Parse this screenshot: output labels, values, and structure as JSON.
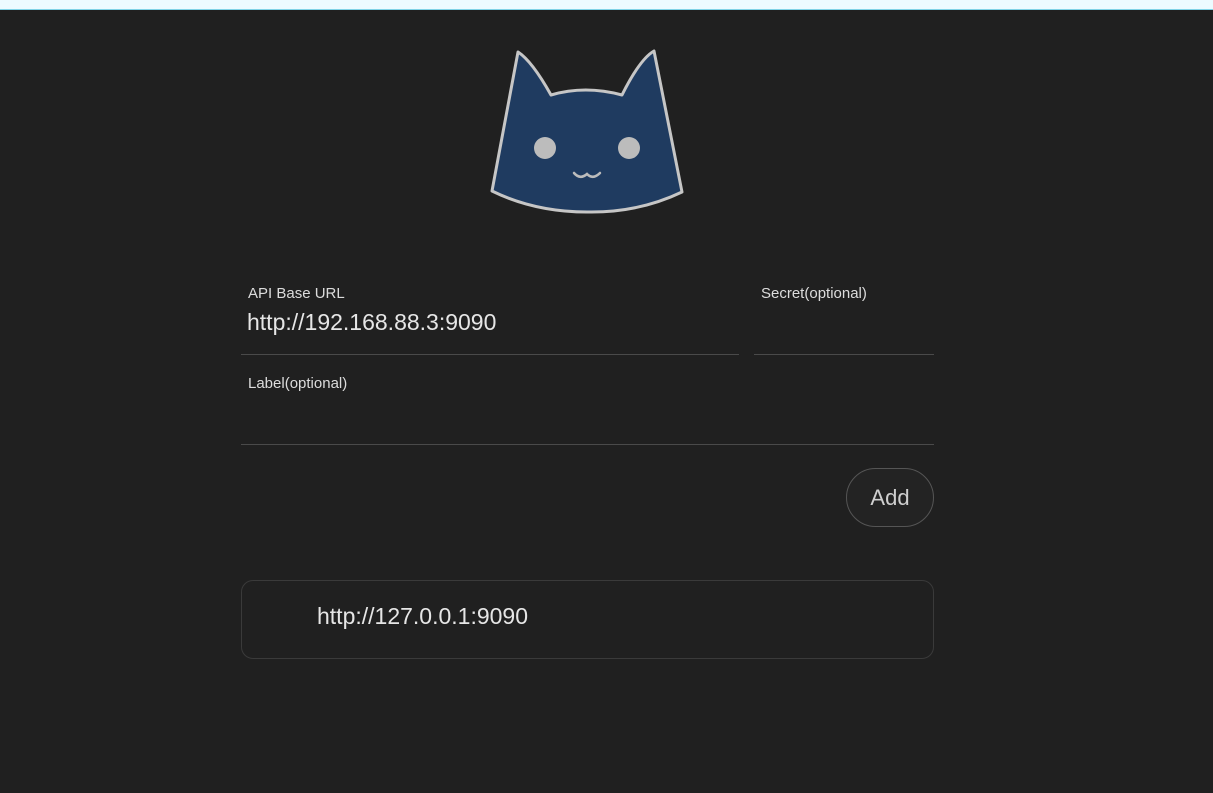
{
  "colors": {
    "background": "#202020",
    "logo_fill": "#1f3b60",
    "logo_stroke": "#c6c6c6",
    "divider": "#4a4a4a"
  },
  "logo": {
    "icon": "cat-face-icon"
  },
  "form": {
    "api_base_url": {
      "label": "API Base URL",
      "value": "http://192.168.88.3:9090"
    },
    "secret": {
      "label": "Secret(optional)",
      "value": ""
    },
    "label": {
      "label": "Label(optional)",
      "value": ""
    },
    "add_label": "Add"
  },
  "backends": [
    {
      "url": "http://127.0.0.1:9090"
    }
  ]
}
